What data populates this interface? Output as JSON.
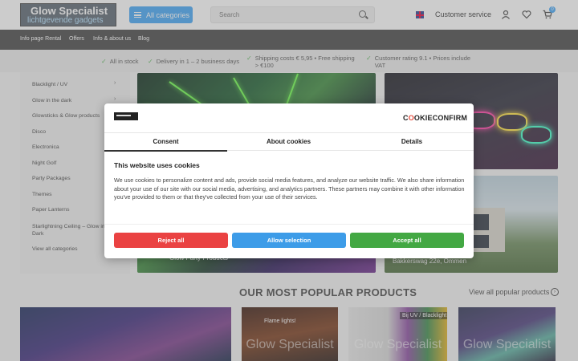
{
  "header": {
    "logo_line1": "Glow Specialist",
    "logo_line2": "lichtgevende gadgets",
    "all_categories": "All categories",
    "search_placeholder": "Search",
    "customer_service": "Customer service",
    "cart_count": "0"
  },
  "nav": [
    "Info page Rental",
    "Offers",
    "Info & about us",
    "Blog"
  ],
  "usp": {
    "item1": "All in stock",
    "item2": "Delivery in 1 – 2 business days",
    "item3_line1": "Shipping costs € 5,95 • Free shipping",
    "item3_line2": "> €100",
    "item4_line1": "Customer rating 9.1 • Prices include",
    "item4_line2": "VAT"
  },
  "sidebar": [
    {
      "label": "Blacklight / UV",
      "arrow": true
    },
    {
      "label": "Glow in the dark",
      "arrow": true
    },
    {
      "label": "Glowsticks & Glow products",
      "arrow": true
    },
    {
      "label": "Disco",
      "arrow": true
    },
    {
      "label": "Electronica",
      "arrow": true
    },
    {
      "label": "Night Golf",
      "arrow": true
    },
    {
      "label": "Party Packages",
      "arrow": true
    },
    {
      "label": "Themes",
      "arrow": true
    },
    {
      "label": "Paper Lanterns",
      "arrow": true
    },
    {
      "label_line1": "Starlightning Ceiling – Glow in",
      "label_line2": "Dark",
      "arrow": true
    },
    {
      "label": "View all categories",
      "arrow": false
    }
  ],
  "hero": {
    "main_caption": "Glow Party Products",
    "bottom_right_caption": "Bakkerswag 22e, Ommen"
  },
  "popular": {
    "title": "OUR MOST POPULAR PRODUCTS",
    "view_all": "View all popular products",
    "watermark": "Glow Specialist",
    "product2_label": "Flame lights!",
    "product3_badge": "Bij UV / Blacklight"
  },
  "cookie_modal": {
    "brand_prefix": "C",
    "brand_o": "O",
    "brand_rest": "OKIECONFIRM",
    "tabs": [
      "Consent",
      "About cookies",
      "Details"
    ],
    "title": "This website uses cookies",
    "text": "We use cookies to personalize content and ads, provide social media features, and analyze our website traffic. We also share information about your use of our site with our social media, advertising, and analytics partners. These partners may combine it with other information you've provided to them or that they've collected from your use of their services.",
    "buttons": {
      "reject": "Reject all",
      "allow_selection": "Allow selection",
      "accept": "Accept all"
    }
  },
  "colors": {
    "accent_blue": "#42a5f5",
    "reject_red": "#ea4242",
    "allow_blue": "#3d9ce8",
    "accept_green": "#43a843",
    "nav_dark": "#444444"
  }
}
